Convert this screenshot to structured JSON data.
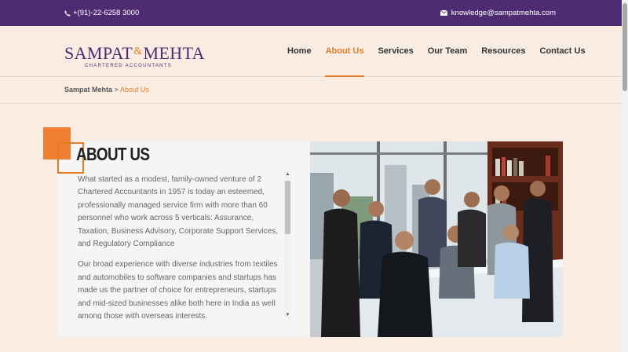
{
  "topbar": {
    "phone": "+(91)-22-6258 3000",
    "email": "knowledge@sampatmehta.com",
    "icons": {
      "phone": "phone-icon",
      "email": "envelope-icon"
    }
  },
  "logo": {
    "name_left": "SAMPAT",
    "ampersand": "&",
    "name_right": "MEHTA",
    "tagline": "CHARTERED ACCOUNTANTS"
  },
  "nav": {
    "items": [
      {
        "label": "Home",
        "active": false
      },
      {
        "label": "About Us",
        "active": true
      },
      {
        "label": "Services",
        "active": false
      },
      {
        "label": "Our Team",
        "active": false
      },
      {
        "label": "Resources",
        "active": false
      },
      {
        "label": "Contact Us",
        "active": false
      }
    ]
  },
  "breadcrumb": {
    "home": "Sampat Mehta",
    "separator": ">",
    "current": "About Us"
  },
  "about": {
    "heading": "ABOUT US",
    "paragraphs": [
      "What started as a modest, family-owned venture of 2 Chartered Accountants in 1957 is today an esteemed, professionally managed service firm with more than 60 personnel who work across 5 verticals: Assurance, Taxation, Business Advisory,  Corporate Support Services, and Regulatory Compliance",
      "Our broad experience with diverse industries from textiles and automobiles to software companies and startups has made us the partner of choice for entrepreneurs, startups and mid-sized businesses alike both here in India as well among those with overseas interests."
    ]
  },
  "colors": {
    "brand_purple": "#4e2c71",
    "accent_orange": "#e27d26",
    "page_bg": "#f8ece3"
  }
}
